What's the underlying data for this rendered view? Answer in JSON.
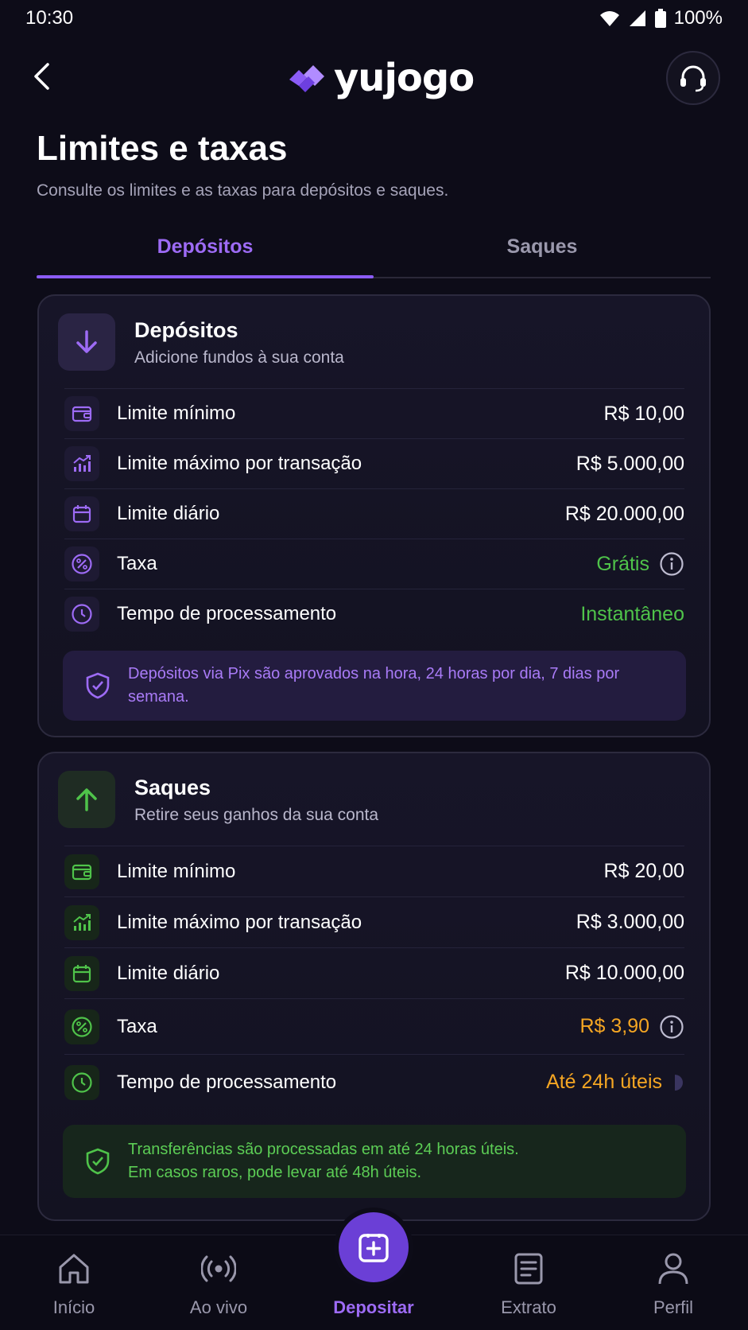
{
  "status_bar": {
    "time": "10:30",
    "battery": "100%"
  },
  "header": {
    "logo_text": "yujogo"
  },
  "page": {
    "title": "Limites e taxas",
    "subtitle": "Consulte os limites e as taxas para depósitos e saques."
  },
  "tabs": [
    {
      "label": "Depósitos",
      "active": true
    },
    {
      "label": "Saques",
      "active": false
    }
  ],
  "deposits": {
    "title": "Depósitos",
    "subtitle": "Adicione fundos à sua conta",
    "rows": [
      {
        "label": "Limite mínimo",
        "value": "R$ 10,00"
      },
      {
        "label": "Limite máximo por transação",
        "value": "R$ 5.000,00"
      },
      {
        "label": "Limite diário",
        "value": "R$ 20.000,00"
      },
      {
        "label": "Taxa",
        "value": "Grátis"
      },
      {
        "label": "Tempo de processamento",
        "value": "Instantâneo"
      }
    ],
    "note": "Depósitos via Pix são aprovados na hora, 24 horas por dia, 7 dias por semana."
  },
  "withdrawals": {
    "title": "Saques",
    "subtitle": "Retire seus ganhos da sua conta",
    "rows": [
      {
        "label": "Limite mínimo",
        "value": "R$ 20,00"
      },
      {
        "label": "Limite máximo por transação",
        "value": "R$ 3.000,00"
      },
      {
        "label": "Limite diário",
        "value": "R$ 10.000,00"
      },
      {
        "label": "Taxa",
        "value": "R$ 3,90"
      },
      {
        "label": "Tempo de processamento",
        "value": "Até 24h úteis"
      }
    ],
    "note_line1": "Transferências são processadas em até 24 horas úteis.",
    "note_line2": "Em casos raros, pode levar até 48h úteis."
  },
  "bottom_nav": [
    {
      "label": "Início",
      "icon": "home-icon"
    },
    {
      "label": "Ao vivo",
      "icon": "live-broadcast-icon"
    },
    {
      "label": "Depositar",
      "icon": "plus-square-icon"
    },
    {
      "label": "Extrato",
      "icon": "document-icon"
    },
    {
      "label": "Perfil",
      "icon": "user-icon"
    }
  ],
  "colors": {
    "accent_purple": "#8b5cf6",
    "green": "#4fc34a",
    "orange": "#f5a623",
    "background": "#0d0c18"
  }
}
